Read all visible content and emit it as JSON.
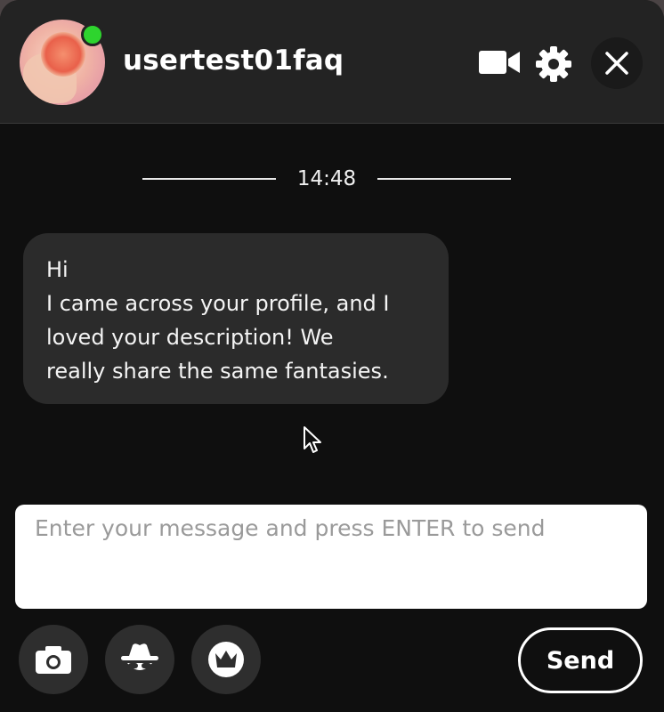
{
  "header": {
    "username": "usertest01faq",
    "online": true,
    "icons": [
      "video-camera-icon",
      "gear-icon",
      "close-icon"
    ]
  },
  "conversation": {
    "time": "14:48",
    "messages": [
      {
        "lines": [
          "Hi",
          "I came across your profile, and I",
          "loved your description! We",
          "really share the same fantasies."
        ]
      }
    ]
  },
  "composer": {
    "placeholder": "Enter your message and press ENTER to send",
    "value": "",
    "actions": [
      "camera-icon",
      "incognito-icon",
      "crown-icon"
    ],
    "send_label": "Send"
  },
  "colors": {
    "background": "#0f0f0f",
    "header": "#232323",
    "bubble": "#2b2b2b",
    "online": "#2ed42e",
    "text": "#ffffff"
  }
}
